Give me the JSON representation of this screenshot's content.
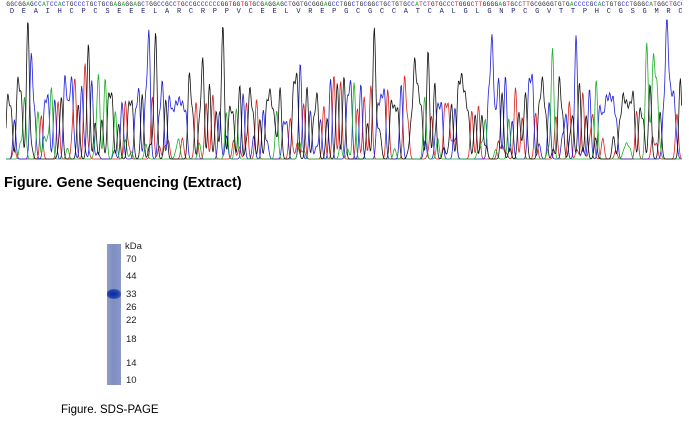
{
  "sequence": {
    "dna_label": "GGCGGAGCCATCCACTGCCCTGCTGCGAGAGGAGCTGGCCGCCTGCCGCCCCCCGGTGGTGTGCGAGGAGCTGGTGCGGGAGCCTGGCTGCGGCTGCTGTGCCATCTGTGCCCTGGGCTTGGGGAGTGCCTTGCGGGGTGTGACCCCGCACTGTGCCTGGGCATGGCTGCGTGCTACCCCCCGGGGGTGGAGAAGCCCCTGCG",
    "dna_letters": [
      "G",
      "G",
      "C",
      "G",
      "G",
      "A",
      "G",
      "C",
      "C",
      "A",
      "T",
      "C",
      "C",
      "A",
      "C",
      "T",
      "G",
      "C",
      "C",
      "C",
      "T",
      "G",
      "C",
      "T",
      "G",
      "C",
      "G",
      "A",
      "G",
      "A",
      "G",
      "G",
      "A",
      "G",
      "C",
      "T",
      "G",
      "G",
      "C",
      "C",
      "G",
      "C",
      "C",
      "T",
      "G",
      "C",
      "C",
      "G",
      "C",
      "C",
      "C",
      "C",
      "C",
      "C",
      "G",
      "G",
      "T",
      "G",
      "G",
      "T",
      "G",
      "T",
      "G",
      "C",
      "G",
      "A",
      "G",
      "G",
      "A",
      "G",
      "C",
      "T",
      "G",
      "G",
      "T",
      "G",
      "C",
      "G",
      "G",
      "G",
      "A",
      "G",
      "C",
      "C",
      "T",
      "G",
      "G",
      "C",
      "T",
      "G",
      "C",
      "G",
      "G",
      "C",
      "T",
      "G",
      "C",
      "T",
      "G",
      "T",
      "G",
      "C",
      "C",
      "A",
      "T",
      "C",
      "T",
      "G",
      "T",
      "G",
      "C",
      "C",
      "C",
      "T",
      "G",
      "G",
      "G",
      "C",
      "T",
      "T",
      "G",
      "G",
      "G",
      "G",
      "A",
      "G",
      "T",
      "G",
      "C",
      "C",
      "T",
      "T",
      "G",
      "C",
      "G",
      "G",
      "G",
      "G",
      "T",
      "G",
      "T",
      "G",
      "A",
      "C",
      "C",
      "C",
      "C",
      "G",
      "C",
      "A",
      "C",
      "T",
      "G",
      "T",
      "G",
      "C",
      "C",
      "T",
      "G",
      "G",
      "G",
      "C",
      "A",
      "T",
      "G",
      "G",
      "C",
      "T",
      "G",
      "C",
      "G",
      "T",
      "G",
      "C",
      "T",
      "A",
      "C",
      "C",
      "C",
      "C",
      "C",
      "C",
      "G",
      "G",
      "G",
      "G",
      "G",
      "T",
      "G",
      "G",
      "A",
      "G",
      "A",
      "A",
      "G",
      "C",
      "C",
      "C",
      "C",
      "T",
      "G"
    ],
    "amino_acids": [
      "D",
      "E",
      "A",
      "I",
      "H",
      "C",
      "P",
      "C",
      "S",
      "E",
      "E",
      "E",
      "L",
      "A",
      "R",
      "C",
      "R",
      "P",
      "P",
      "V",
      "C",
      "E",
      "E",
      "L",
      "V",
      "R",
      "E",
      "P",
      "G",
      "C",
      "G",
      "C",
      "C",
      "A",
      "T",
      "C",
      "A",
      "L",
      "G",
      "L",
      "G",
      "N",
      "P",
      "C",
      "G",
      "V",
      "T",
      "T",
      "P",
      "H",
      "C",
      "G",
      "S",
      "G",
      "M",
      "R",
      "C",
      "Y",
      "P",
      "P",
      "R",
      "G",
      "V",
      "E",
      "K",
      "P",
      "L",
      "R"
    ],
    "base_colors": {
      "A": "#1fae2a",
      "C": "#1f1fd6",
      "G": "#111111",
      "T": "#d92020"
    }
  },
  "figure1": {
    "caption": "Figure. Gene Sequencing (Extract)"
  },
  "figure2": {
    "caption": "Figure. SDS-PAGE",
    "unit_label": "kDa",
    "markers": [
      "70",
      "44",
      "33",
      "26",
      "22",
      "18",
      "14",
      "10"
    ],
    "band_kda": "33"
  }
}
